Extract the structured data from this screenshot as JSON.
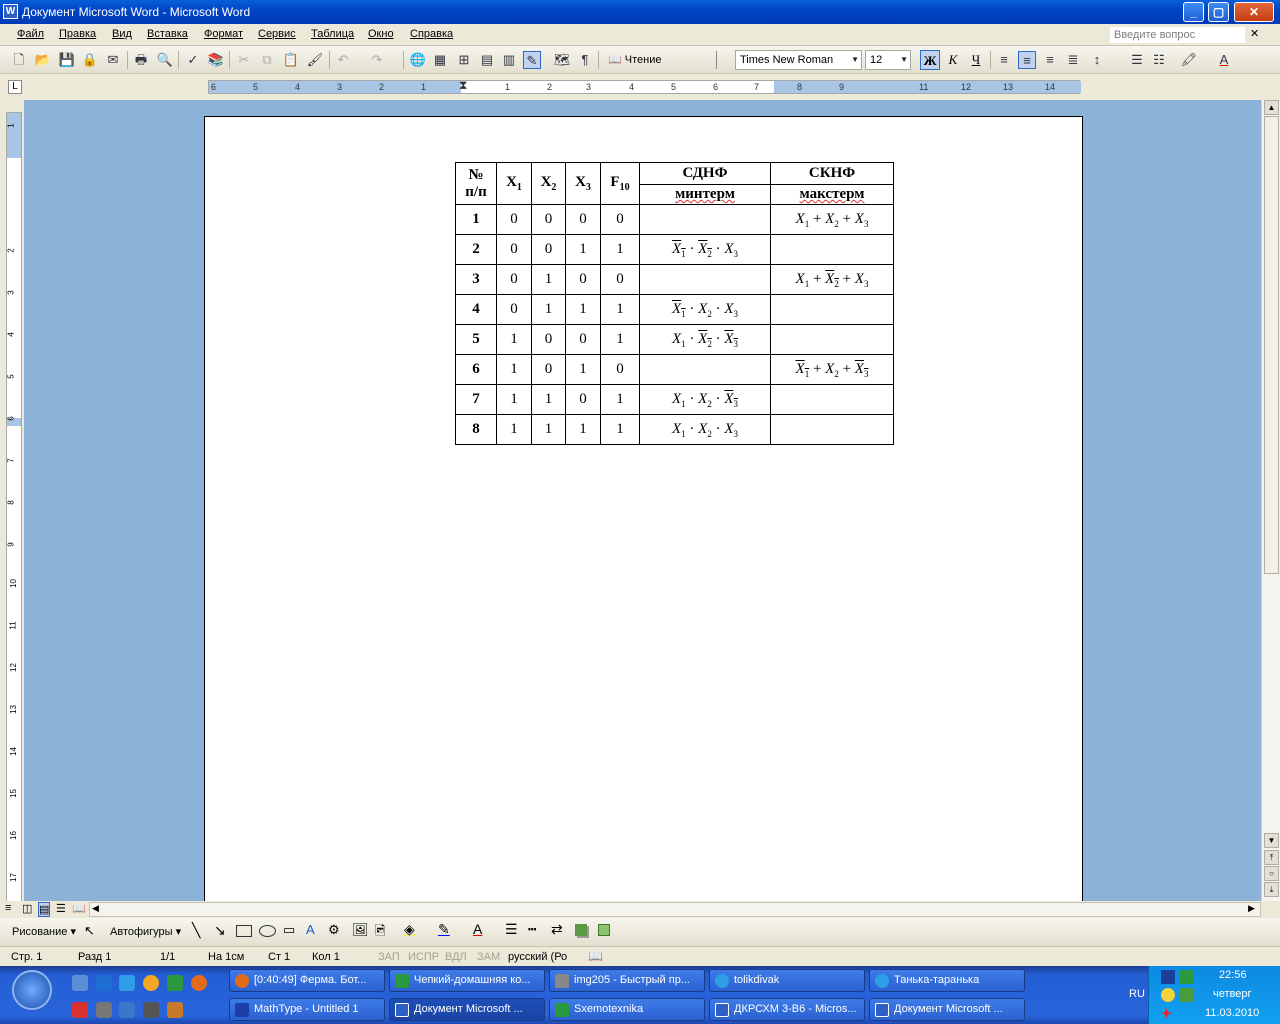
{
  "window": {
    "title": "Документ Microsoft Word - Microsoft Word"
  },
  "menu": {
    "items": [
      "Файл",
      "Правка",
      "Вид",
      "Вставка",
      "Формат",
      "Сервис",
      "Таблица",
      "Окно",
      "Справка"
    ],
    "ask_placeholder": "Введите вопрос"
  },
  "toolbar": {
    "reading_label": "Чтение",
    "font_name": "Times New Roman",
    "font_size": "12",
    "bold": "Ж",
    "italic": "К",
    "underline": "Ч"
  },
  "ruler": {
    "h_numbers": [
      "6",
      "5",
      "4",
      "3",
      "2",
      "1",
      "1",
      "2",
      "3",
      "4",
      "5",
      "6",
      "7",
      "8",
      "9",
      "11",
      "12",
      "13",
      "14"
    ],
    "v_numbers": [
      "1",
      "2",
      "3",
      "4",
      "5",
      "6",
      "7",
      "8",
      "9",
      "10",
      "11",
      "12",
      "13",
      "14",
      "15",
      "16",
      "17"
    ]
  },
  "table": {
    "header": {
      "num": "№",
      "num2": "п/п",
      "x1": "X",
      "x1_sub": "1",
      "x2": "X",
      "x2_sub": "2",
      "x3": "X",
      "x3_sub": "3",
      "f": "F",
      "f_sub": "10",
      "sdnf": "СДНФ",
      "sdnf_sub": "минтерм",
      "sknf": "СКНФ",
      "sknf_sub": "макстерм"
    },
    "rows": [
      {
        "n": "1",
        "x1": "0",
        "x2": "0",
        "x3": "0",
        "f": "0"
      },
      {
        "n": "2",
        "x1": "0",
        "x2": "0",
        "x3": "1",
        "f": "1"
      },
      {
        "n": "3",
        "x1": "0",
        "x2": "1",
        "x3": "0",
        "f": "0"
      },
      {
        "n": "4",
        "x1": "0",
        "x2": "1",
        "x3": "1",
        "f": "1"
      },
      {
        "n": "5",
        "x1": "1",
        "x2": "0",
        "x3": "0",
        "f": "1"
      },
      {
        "n": "6",
        "x1": "1",
        "x2": "0",
        "x3": "1",
        "f": "0"
      },
      {
        "n": "7",
        "x1": "1",
        "x2": "1",
        "x3": "0",
        "f": "1"
      },
      {
        "n": "8",
        "x1": "1",
        "x2": "1",
        "x3": "1",
        "f": "1"
      }
    ],
    "term_var": "X",
    "term_subs": [
      "1",
      "2",
      "3"
    ],
    "op_and": "·",
    "op_or": "+"
  },
  "drawbar": {
    "draw_label": "Рисование",
    "autoshapes_label": "Автофигуры"
  },
  "status": {
    "page": "Стр. 1",
    "section": "Разд 1",
    "pages": "1/1",
    "at": "На 1см",
    "line": "Ст 1",
    "col": "Кол 1",
    "rec": "ЗАП",
    "trk": "ИСПР",
    "ext": "ВДЛ",
    "ovr": "ЗАМ",
    "lang": "русский (Ро"
  },
  "taskbar": {
    "row1": [
      "[0:40:49] Ферма. Бот...",
      "Чепкий-домашняя ко...",
      "img205 - Быстрый пр...",
      "tolikdivak",
      "Танька-таранька"
    ],
    "row2": [
      "MathType - Untitled 1",
      "Документ Microsoft ...",
      "Sxemotexnika",
      "ДКРСХМ 3-В6 - Micros...",
      "Документ Microsoft ..."
    ],
    "lang": "RU",
    "time": "22:56",
    "day": "четверг",
    "date": "11.03.2010"
  }
}
